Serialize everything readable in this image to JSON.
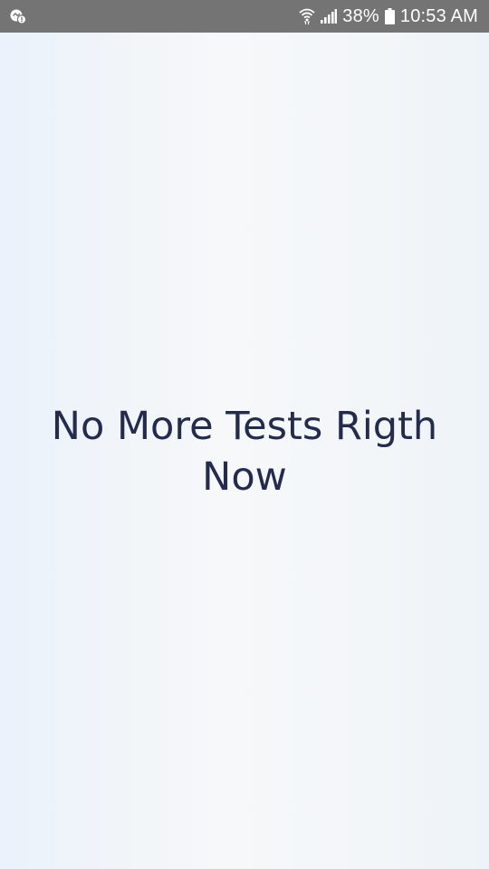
{
  "status_bar": {
    "left_icon": "notification-alert-icon",
    "wifi_icon": "wifi-icon",
    "signal_icon": "cell-signal-icon",
    "battery_percent": "38%",
    "battery_icon": "battery-icon",
    "time": "10:53 AM"
  },
  "main": {
    "message": "No More Tests Rigth Now"
  },
  "colors": {
    "status_bar_bg": "#747474",
    "message_text": "#242b4c"
  }
}
